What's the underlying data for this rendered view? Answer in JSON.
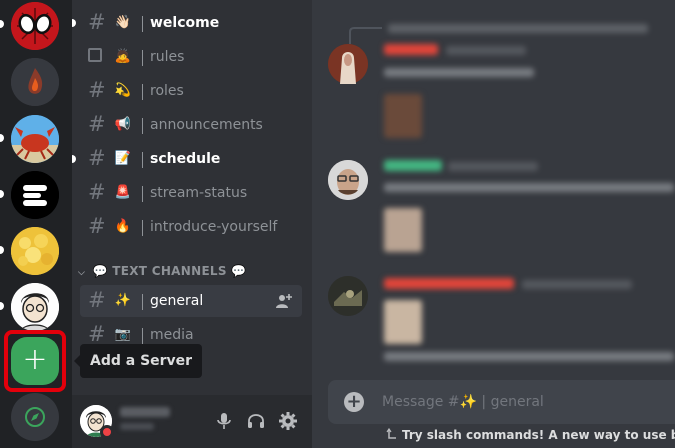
{
  "channels": [
    {
      "name": "welcome",
      "emoji": "👋🏻",
      "unread": true
    },
    {
      "name": "rules",
      "emoji": "🙇",
      "unread": false,
      "rules": true
    },
    {
      "name": "roles",
      "emoji": "💫",
      "unread": false
    },
    {
      "name": "announcements",
      "emoji": "📢",
      "unread": false
    },
    {
      "name": "schedule",
      "emoji": "📝",
      "unread": true
    },
    {
      "name": "stream-status",
      "emoji": "🚨",
      "unread": false
    },
    {
      "name": "introduce-yourself",
      "emoji": "🔥",
      "unread": false
    }
  ],
  "category": {
    "label": "TEXT CHANNELS",
    "emoji": "💬"
  },
  "text_channels": [
    {
      "name": "general",
      "emoji": "✨",
      "active": true
    },
    {
      "name": "media",
      "emoji": "📷",
      "active": false
    }
  ],
  "tooltip": {
    "text": "Add a Server"
  },
  "rail": {
    "add_symbol": "+"
  },
  "composer": {
    "placeholder": "Message #✨ | general",
    "plus": "+"
  },
  "tip": {
    "text": "Try slash commands! A new way to use bots by"
  },
  "icons": {
    "add_server": "plus-icon",
    "explore": "compass-icon",
    "mic": "microphone-icon",
    "headset": "headphones-icon",
    "settings": "gear-icon",
    "invite": "add-member-icon",
    "channel": "hash-icon"
  },
  "colors": {
    "rail_bg": "#202225",
    "sidebar_bg": "#2f3136",
    "chat_bg": "#36393f",
    "add_server_green": "#3ba55c",
    "highlight_box": "#e3000b",
    "dnd_red": "#ed4245"
  }
}
